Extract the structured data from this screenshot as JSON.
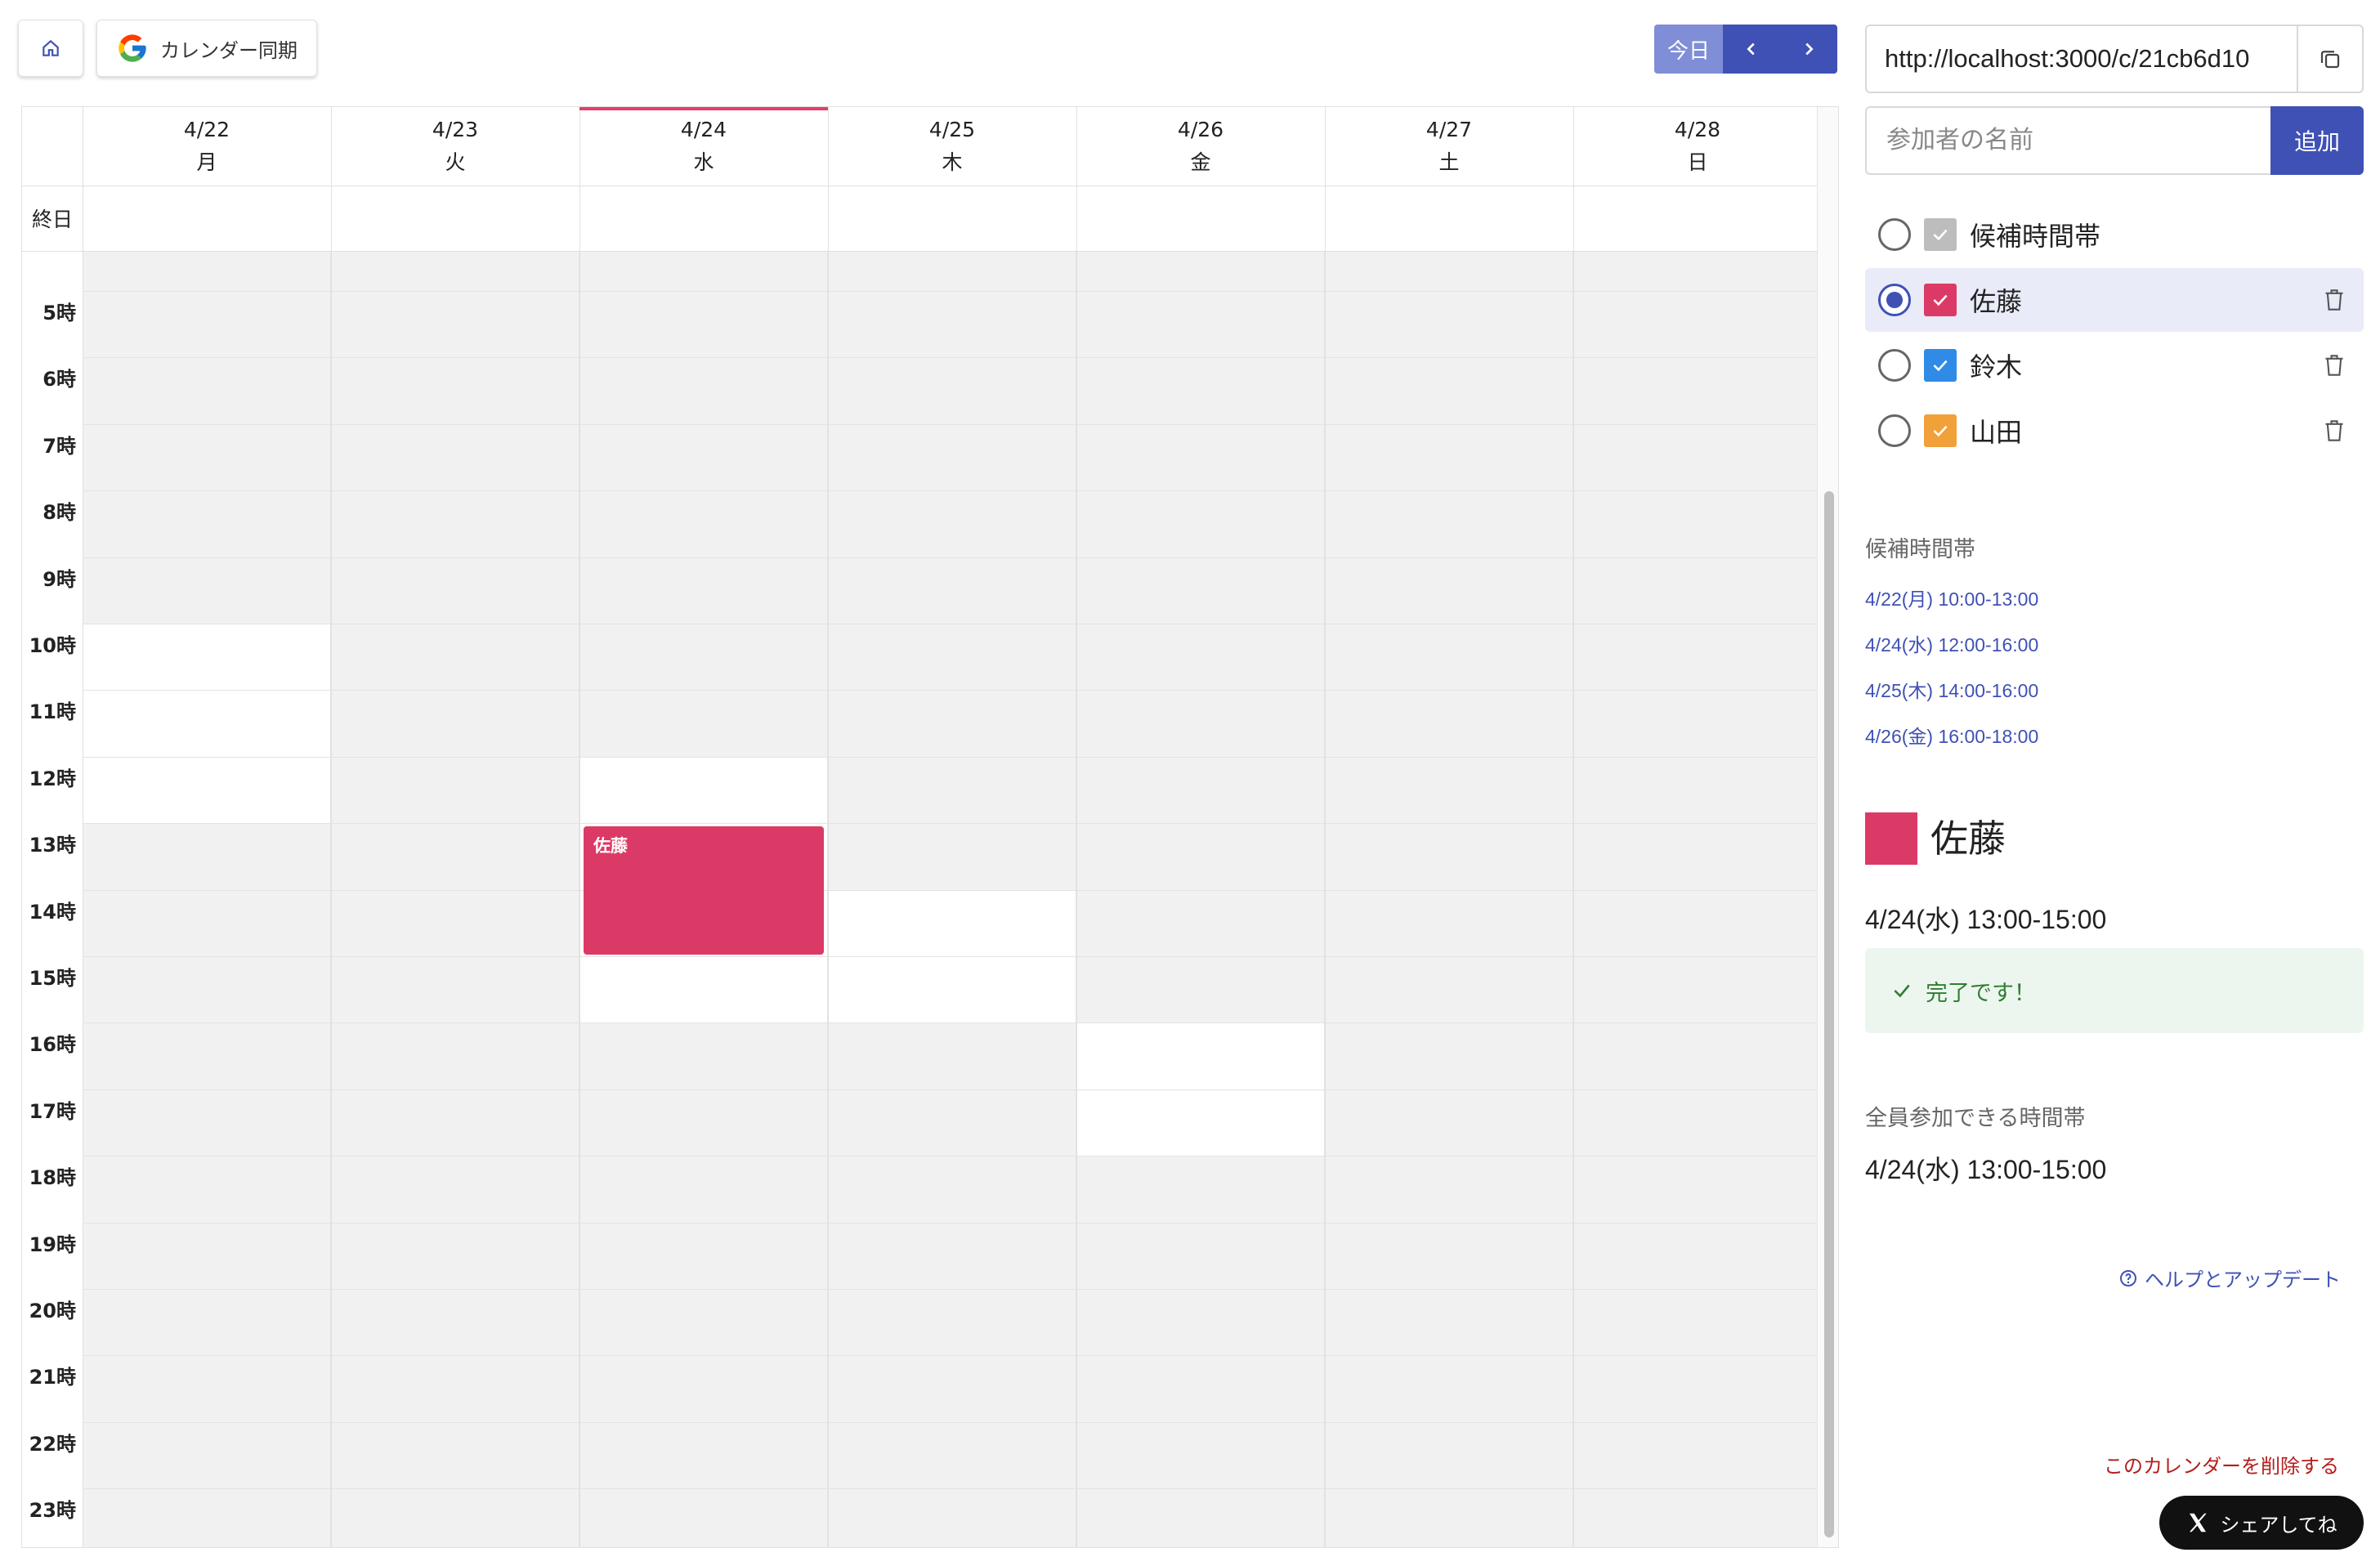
{
  "toolbar": {
    "sync_label": "カレンダー同期",
    "today_label": "今日"
  },
  "calendar": {
    "allday_label": "終日",
    "days": [
      {
        "date": "4/22",
        "weekday": "月"
      },
      {
        "date": "4/23",
        "weekday": "火"
      },
      {
        "date": "4/24",
        "weekday": "水"
      },
      {
        "date": "4/25",
        "weekday": "木"
      },
      {
        "date": "4/26",
        "weekday": "金"
      },
      {
        "date": "4/27",
        "weekday": "土"
      },
      {
        "date": "4/28",
        "weekday": "日"
      }
    ],
    "today_index": 2,
    "hours": [
      "5時",
      "6時",
      "7時",
      "8時",
      "9時",
      "10時",
      "11時",
      "12時",
      "13時",
      "14時",
      "15時",
      "16時",
      "17時",
      "18時",
      "19時",
      "20時",
      "21時",
      "22時",
      "23時"
    ],
    "first_hour": 5,
    "candidate_slots": [
      {
        "day": 0,
        "start": 10,
        "end": 13
      },
      {
        "day": 2,
        "start": 12,
        "end": 16
      },
      {
        "day": 3,
        "start": 14,
        "end": 16
      },
      {
        "day": 4,
        "start": 16,
        "end": 18
      }
    ],
    "events": [
      {
        "day": 2,
        "start": 13,
        "end": 15,
        "label": "佐藤",
        "color": "#dc3a66"
      }
    ]
  },
  "share": {
    "url": "http://localhost:3000/c/21cb6d10",
    "name_placeholder": "参加者の名前",
    "add_label": "追加"
  },
  "participants": [
    {
      "name": "候補時間帯",
      "color": "#bdbdbd",
      "selected": false,
      "deletable": false
    },
    {
      "name": "佐藤",
      "color": "#dc3a66",
      "selected": true,
      "deletable": true
    },
    {
      "name": "鈴木",
      "color": "#2f8be6",
      "selected": false,
      "deletable": true
    },
    {
      "name": "山田",
      "color": "#f2a03a",
      "selected": false,
      "deletable": true
    }
  ],
  "candidates": {
    "title": "候補時間帯",
    "items": [
      "4/22(月) 10:00-13:00",
      "4/24(水) 12:00-16:00",
      "4/25(木) 14:00-16:00",
      "4/26(金) 16:00-18:00"
    ]
  },
  "selected_participant": {
    "name": "佐藤",
    "color": "#dc3a66",
    "time": "4/24(水) 13:00-15:00",
    "status": "完了です！"
  },
  "all_available": {
    "title": "全員参加できる時間帯",
    "time": "4/24(水) 13:00-15:00"
  },
  "footer": {
    "help_label": "ヘルプとアップデート",
    "delete_label": "このカレンダーを削除する",
    "share_label": "シェアしてね"
  }
}
